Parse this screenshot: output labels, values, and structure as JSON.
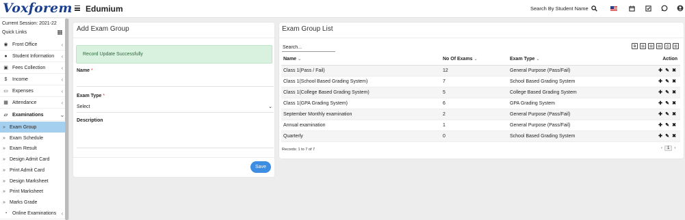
{
  "brand": {
    "logo": "Voxforem",
    "app_name": "Edumium"
  },
  "topbar": {
    "search_label": "Search By Student Name",
    "icons": [
      "search-icon",
      "flag-icon",
      "calendar-icon",
      "task-check-icon",
      "whatsapp-icon",
      "user-avatar-icon"
    ]
  },
  "sidebar": {
    "session": "Current Session: 2021-22",
    "quick_links": "Quick Links",
    "items": [
      {
        "label": "Front Office",
        "icon": "front-office-icon"
      },
      {
        "label": "Student Information",
        "icon": "student-icon"
      },
      {
        "label": "Fees Collection",
        "icon": "fees-icon"
      },
      {
        "label": "Income",
        "icon": "dollar-icon"
      },
      {
        "label": "Expenses",
        "icon": "credit-card-icon"
      },
      {
        "label": "Attendance",
        "icon": "calendar-icon"
      },
      {
        "label": "Examinations",
        "icon": "map-icon"
      }
    ],
    "sub_items": [
      "Exam Group",
      "Exam Schedule",
      "Exam Result",
      "Design Admit Card",
      "Print Admit Card",
      "Design Marksheet",
      "Print Marksheet",
      "Marks Grade"
    ],
    "online_exams": "Online Examinations"
  },
  "add_form": {
    "title": "Add Exam Group",
    "alert": "Record Update Successfully",
    "name_label": "Name",
    "exam_type_label": "Exam Type",
    "exam_type_value": "Select",
    "description_label": "Description",
    "required_mark": "*",
    "save_label": "Save"
  },
  "list": {
    "title": "Exam Group List",
    "search_placeholder": "Search...",
    "columns": [
      "Name",
      "No Of Exams",
      "Exam Type",
      "Action"
    ],
    "rows": [
      {
        "name": "Class 1(Pass / Fail)",
        "exams": "12",
        "type": "General Purpose (Pass/Fail)"
      },
      {
        "name": "Class 1(School Based Grading System)",
        "exams": "7",
        "type": "School Based Grading System"
      },
      {
        "name": "Class 1(College Based Grading System)",
        "exams": "5",
        "type": "College Based Grading System"
      },
      {
        "name": "Class 1(GPA Grading System)",
        "exams": "6",
        "type": "GPA Grading System"
      },
      {
        "name": "September Monthly examination",
        "exams": "2",
        "type": "General Purpose (Pass/Fail)"
      },
      {
        "name": "Annual examination",
        "exams": "1",
        "type": "General Purpose (Pass/Fail)"
      },
      {
        "name": "Quarterly",
        "exams": "0",
        "type": "School Based Grading System"
      }
    ],
    "records": "Records: 1 to 7 of 7",
    "page": "1",
    "export_tools": [
      "copy-icon",
      "excel-icon",
      "csv-icon",
      "pdf-icon",
      "print-icon",
      "columns-icon"
    ]
  },
  "colors": {
    "logo": "#1a3f8f",
    "active_menu": "#a5cfef",
    "alert_bg": "#d9f1df",
    "save_button": "#3d8de3"
  }
}
